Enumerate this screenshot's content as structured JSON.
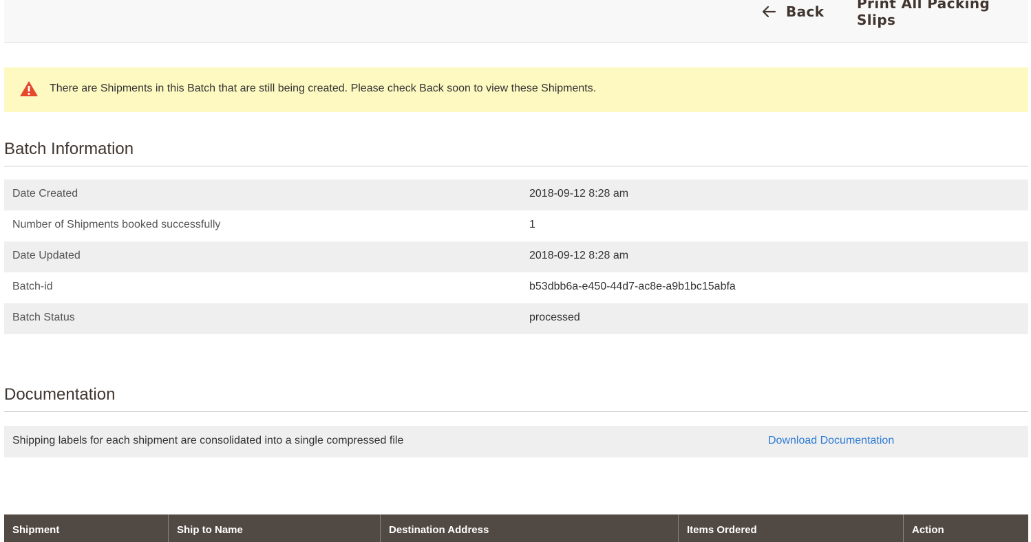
{
  "page_actions": {
    "back_label": "Back",
    "print_label": "Print All Packing Slips"
  },
  "message": {
    "text": "There are Shipments in this Batch that are still being created. Please check Back soon to view these Shipments.",
    "icon": "warning-triangle-icon",
    "color": "#e22626"
  },
  "batch_info": {
    "title": "Batch Information",
    "rows": [
      {
        "label": "Date Created",
        "value": "2018-09-12 8:28 am"
      },
      {
        "label": "Number of Shipments booked successfully",
        "value": "1"
      },
      {
        "label": "Date Updated",
        "value": "2018-09-12 8:28 am"
      },
      {
        "label": "Batch-id",
        "value": "b53dbb6a-e450-44d7-ac8e-a9b1bc15abfa"
      },
      {
        "label": "Batch Status",
        "value": "processed"
      }
    ]
  },
  "documentation": {
    "title": "Documentation",
    "description": "Shipping labels for each shipment are consolidated into a single compressed file",
    "link_label": "Download Documentation"
  },
  "grid": {
    "columns": [
      "Shipment",
      "Ship to Name",
      "Destination Address",
      "Items Ordered",
      "Action"
    ]
  }
}
